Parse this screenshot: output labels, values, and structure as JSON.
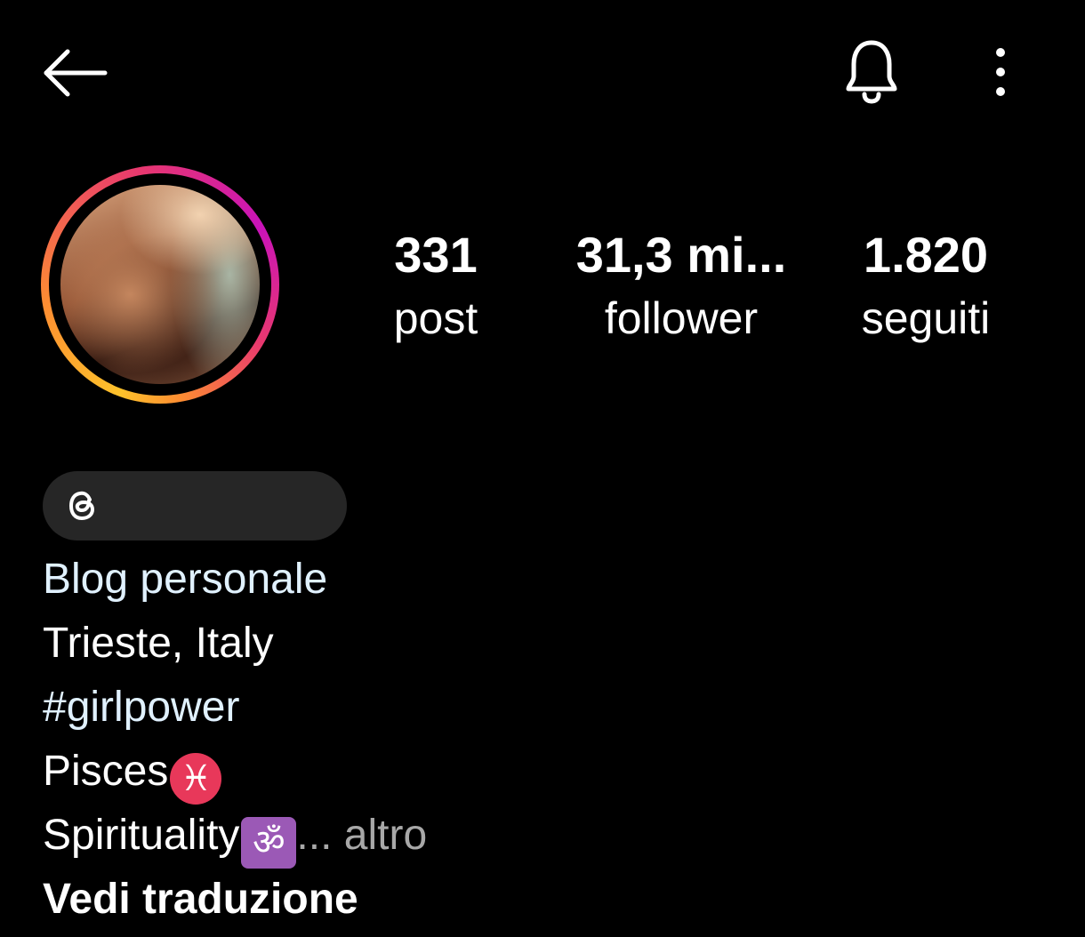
{
  "header": {
    "back_icon": "arrow-left-icon",
    "notifications_icon": "bell-icon",
    "more_icon": "vertical-dots-icon"
  },
  "profile": {
    "avatar_ring_colors": [
      "#fdc22b",
      "#fd8d32",
      "#e8386f",
      "#c913b9"
    ]
  },
  "stats": {
    "posts": {
      "value": "331",
      "label": "post"
    },
    "followers": {
      "value": "31,3 mi...",
      "label": "follower"
    },
    "following": {
      "value": "1.820",
      "label": "seguiti"
    }
  },
  "threads": {
    "icon": "threads-icon"
  },
  "bio": {
    "category": "Blog personale",
    "location": "Trieste, Italy",
    "hashtag": "#girlpower",
    "sign_text": "Pisces",
    "sign_emoji": "♓",
    "spirit_text": "Spirituality",
    "spirit_emoji": "ॐ",
    "truncation": "...",
    "more_label": "altro",
    "translate_label": "Vedi traduzione"
  },
  "colors": {
    "background": "#000000",
    "text": "#ffffff",
    "link": "#e0f1ff",
    "muted": "#a8a8a8",
    "pill": "#262626"
  }
}
